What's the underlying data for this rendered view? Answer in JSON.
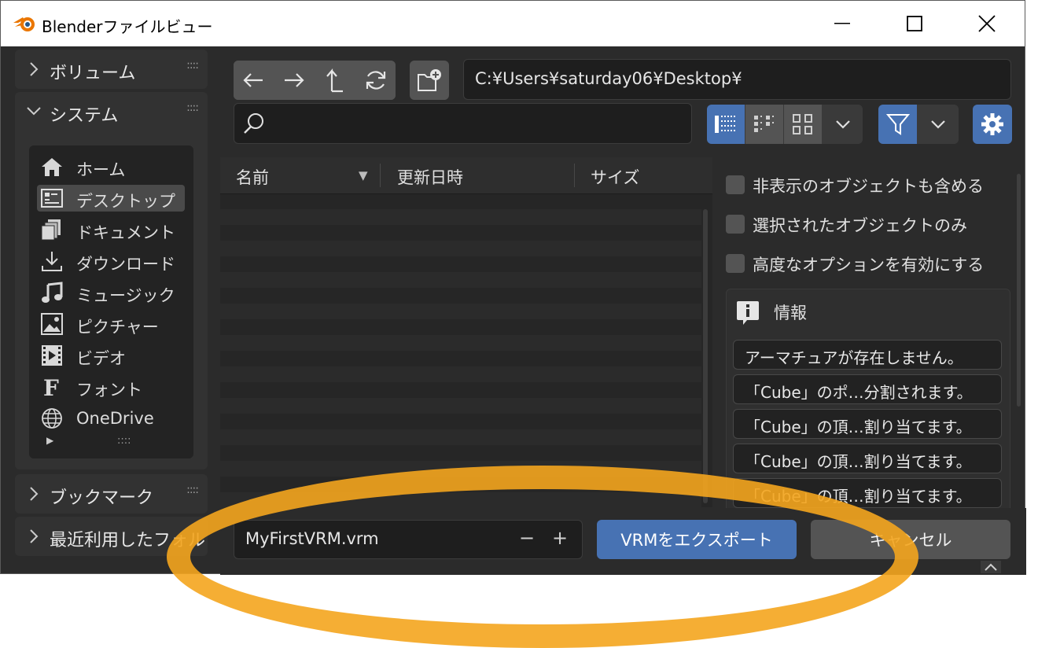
{
  "window": {
    "title": "Blenderファイルビュー"
  },
  "sidebar": {
    "volumes_label": "ボリューム",
    "system_label": "システム",
    "bookmarks_label": "ブックマーク",
    "recent_label": "最近利用したフォル",
    "grip": "::::",
    "system_items": [
      {
        "label": "ホーム",
        "icon": "home-icon"
      },
      {
        "label": "デスクトップ",
        "icon": "desktop-icon",
        "active": true
      },
      {
        "label": "ドキュメント",
        "icon": "documents-icon"
      },
      {
        "label": "ダウンロード",
        "icon": "download-icon"
      },
      {
        "label": "ミュージック",
        "icon": "music-icon"
      },
      {
        "label": "ピクチャー",
        "icon": "picture-icon"
      },
      {
        "label": "ビデオ",
        "icon": "video-icon"
      },
      {
        "label": "フォント",
        "icon": "font-icon"
      },
      {
        "label": "OneDrive",
        "icon": "globe-icon"
      }
    ],
    "expand_arrow": "▶"
  },
  "toolbar": {
    "path": "C:¥Users¥saturday06¥Desktop¥",
    "search_placeholder": ""
  },
  "filelist": {
    "columns": [
      "名前",
      "更新日時",
      "サイズ"
    ],
    "sort_indicator": "▼"
  },
  "options": {
    "checkboxes": [
      {
        "label": "非表示のオブジェクトも含める",
        "checked": false
      },
      {
        "label": "選択されたオブジェクトのみ",
        "checked": false
      },
      {
        "label": "高度なオプションを有効にする",
        "checked": false
      }
    ]
  },
  "info": {
    "header": "情報",
    "messages": [
      "アーマチュアが存在しません。",
      "「Cube」のポ…分割されます。",
      "「Cube」の頂…割り当てます。",
      "「Cube」の頂…割り当てます。",
      "「Cube」の頂…割り当てます。"
    ]
  },
  "footer": {
    "filename": "MyFirstVRM.vrm",
    "minus": "−",
    "plus": "+",
    "export_label": "VRMをエクスポート",
    "cancel_label": "キャンセル"
  },
  "colors": {
    "accent_blue": "#4772b3",
    "highlight_orange": "#f4a51e",
    "panel_bg": "#2b2b2b"
  }
}
